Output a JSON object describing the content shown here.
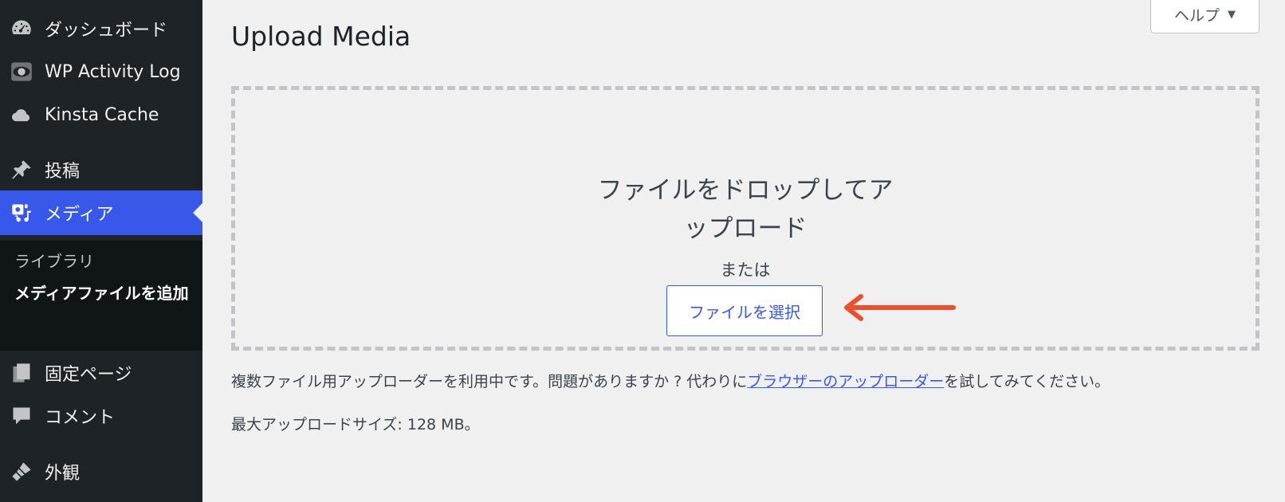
{
  "sidebar": {
    "items": [
      {
        "label": "ダッシュボード",
        "icon": "dashboard-icon"
      },
      {
        "label": "WP Activity Log",
        "icon": "eye-icon"
      },
      {
        "label": "Kinsta Cache",
        "icon": "cloud-icon"
      },
      {
        "label": "投稿",
        "icon": "pin-icon"
      },
      {
        "label": "メディア",
        "icon": "media-icon",
        "active": true
      },
      {
        "label": "固定ページ",
        "icon": "pages-icon"
      },
      {
        "label": "コメント",
        "icon": "comment-icon"
      },
      {
        "label": "外観",
        "icon": "brush-icon"
      }
    ],
    "submenu": [
      {
        "label": "ライブラリ"
      },
      {
        "label": "メディアファイルを追加",
        "current": true
      }
    ]
  },
  "header": {
    "help_label": "ヘルプ",
    "help_caret": "▼",
    "title": "Upload Media"
  },
  "uploader": {
    "drop_line1": "ファイルをドロップしてア",
    "drop_line2": "ップロード",
    "or_text": "または",
    "select_button": "ファイルを選択"
  },
  "notice": {
    "before": "複数ファイル用アップローダーを利用中です。問題がありますか ? 代わりに",
    "link": "ブラウザーのアップローダー",
    "after": "を試してみてください。"
  },
  "max_size": "最大アップロードサイズ: 128 MB。",
  "colors": {
    "sidebar_bg": "#1d2327",
    "accent": "#3858e9",
    "arrow": "#e8502f",
    "page_bg": "#f0f0f1"
  }
}
